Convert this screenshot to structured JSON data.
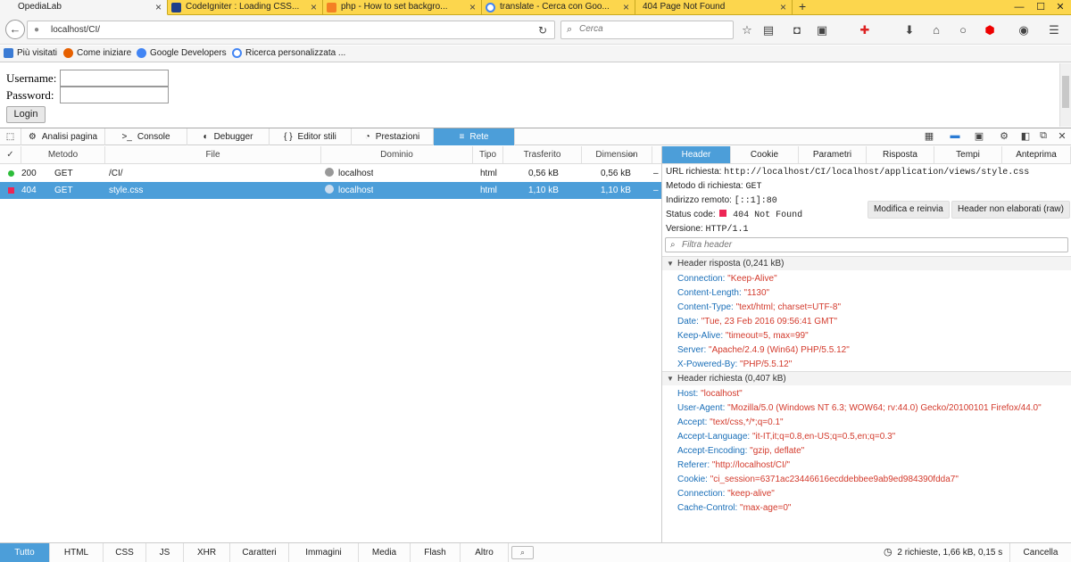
{
  "browser": {
    "tabs": [
      {
        "label": "OpediaLab",
        "active": true
      },
      {
        "label": "CodeIgniter : Loading CSS..."
      },
      {
        "label": "php - How to set backgro..."
      },
      {
        "label": "translate - Cerca con Goo..."
      },
      {
        "label": "404 Page Not Found"
      }
    ],
    "new_tab": "+",
    "url": "localhost/CI/",
    "search_placeholder": "Cerca"
  },
  "bookmarks": [
    {
      "label": "Più visitati"
    },
    {
      "label": "Come iniziare"
    },
    {
      "label": "Google Developers"
    },
    {
      "label": "Ricerca personalizzata ..."
    }
  ],
  "page": {
    "username_label": "Username:",
    "password_label": "Password:",
    "login_button": "Login"
  },
  "devtools": {
    "tabs": [
      {
        "label": "Analisi pagina",
        "icon": "gear-icon"
      },
      {
        "label": "Console",
        "icon": "console-icon"
      },
      {
        "label": "Debugger",
        "icon": "debugger-icon"
      },
      {
        "label": "Editor stili",
        "icon": "braces-icon"
      },
      {
        "label": "Prestazioni",
        "icon": "gauge-icon"
      },
      {
        "label": "Rete",
        "icon": "network-icon",
        "active": true
      }
    ],
    "columns": {
      "check": "✓",
      "method": "Metodo",
      "file": "File",
      "domain": "Dominio",
      "type": "Tipo",
      "transferred": "Trasferito",
      "size": "Dimension"
    },
    "requests": [
      {
        "status": "200",
        "method": "GET",
        "file": "/CI/",
        "domain": "localhost",
        "type": "html",
        "transferred": "0,56 kB",
        "size": "0,56 kB",
        "more": "–"
      },
      {
        "status": "404",
        "method": "GET",
        "file": "style.css",
        "domain": "localhost",
        "type": "html",
        "transferred": "1,10 kB",
        "size": "1,10 kB",
        "more": "–",
        "selected": true
      }
    ],
    "side_tabs": [
      "Header",
      "Cookie",
      "Parametri",
      "Risposta",
      "Tempi",
      "Anteprima"
    ],
    "summary": {
      "url_label": "URL richiesta:",
      "url_value": "http://localhost/CI/localhost/application/views/style.css",
      "method_label": "Metodo di richiesta:",
      "method_value": "GET",
      "remote_label": "Indirizzo remoto:",
      "remote_value": "[::1]:80",
      "status_label": "Status code:",
      "status_value": "404 Not Found",
      "version_label": "Versione:",
      "version_value": "HTTP/1.1",
      "edit_button": "Modifica e reinvia",
      "raw_button": "Header non elaborati (raw)",
      "filter_placeholder": "Filtra header"
    },
    "response_section": "Header risposta (0,241 kB)",
    "response_headers": [
      {
        "name": "Connection:",
        "value": "\"Keep-Alive\""
      },
      {
        "name": "Content-Length:",
        "value": "\"1130\""
      },
      {
        "name": "Content-Type:",
        "value": "\"text/html; charset=UTF-8\""
      },
      {
        "name": "Date:",
        "value": "\"Tue, 23 Feb 2016 09:56:41 GMT\""
      },
      {
        "name": "Keep-Alive:",
        "value": "\"timeout=5, max=99\""
      },
      {
        "name": "Server:",
        "value": "\"Apache/2.4.9 (Win64) PHP/5.5.12\""
      },
      {
        "name": "X-Powered-By:",
        "value": "\"PHP/5.5.12\""
      }
    ],
    "request_section": "Header richiesta (0,407 kB)",
    "request_headers": [
      {
        "name": "Host:",
        "value": "\"localhost\""
      },
      {
        "name": "User-Agent:",
        "value": "\"Mozilla/5.0 (Windows NT 6.3; WOW64; rv:44.0) Gecko/20100101 Firefox/44.0\""
      },
      {
        "name": "Accept:",
        "value": "\"text/css,*/*;q=0.1\""
      },
      {
        "name": "Accept-Language:",
        "value": "\"it-IT,it;q=0.8,en-US;q=0.5,en;q=0.3\""
      },
      {
        "name": "Accept-Encoding:",
        "value": "\"gzip, deflate\""
      },
      {
        "name": "Referer:",
        "value": "\"http://localhost/CI/\""
      },
      {
        "name": "Cookie:",
        "value": "\"ci_session=6371ac23446616ecddebbee9ab9ed984390fdda7\""
      },
      {
        "name": "Connection:",
        "value": "\"keep-alive\""
      },
      {
        "name": "Cache-Control:",
        "value": "\"max-age=0\""
      }
    ],
    "filters": [
      "Tutto",
      "HTML",
      "CSS",
      "JS",
      "XHR",
      "Caratteri",
      "Immagini",
      "Media",
      "Flash",
      "Altro"
    ],
    "footer_summary": "2 richieste, 1,66 kB, 0,15 s",
    "cancel_label": "Cancella"
  },
  "colors": {
    "accent": "#4c9ed9",
    "status_ok": "#2dbd3a",
    "status_err": "#ed2655",
    "tabstrip": "#fcd64d"
  }
}
